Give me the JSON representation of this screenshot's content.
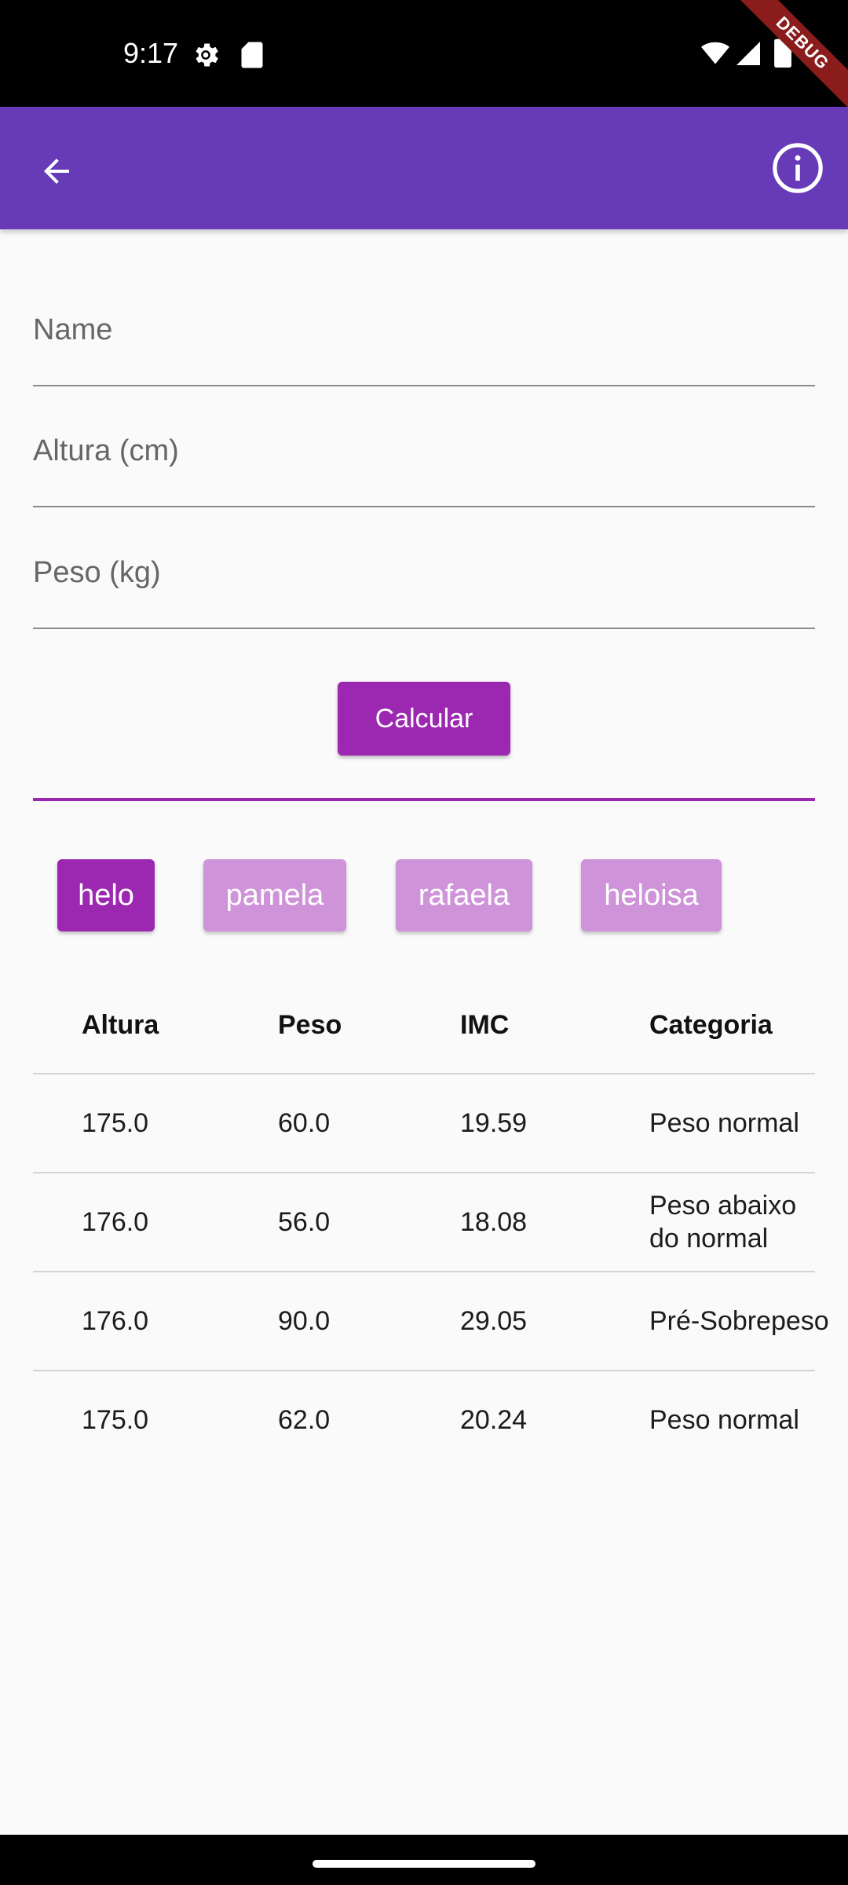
{
  "status_bar": {
    "time": "9:17",
    "debug_label": "DEBUG",
    "icons": [
      "settings-gear-icon",
      "sd-card-icon",
      "wifi-icon",
      "cell-signal-icon",
      "battery-icon"
    ]
  },
  "app_bar": {
    "color": "#673ab7",
    "back_icon": "arrow-back-icon",
    "info_icon": "info-outline-icon"
  },
  "form": {
    "name_placeholder": "Name",
    "name_value": "",
    "height_placeholder": "Altura (cm)",
    "height_value": "",
    "weight_placeholder": "Peso (kg)",
    "weight_value": "",
    "calculate_label": "Calcular"
  },
  "colors": {
    "accent": "#9c27b0",
    "chip_selected": "#9c27b0",
    "chip_unselected": "#ce93d8"
  },
  "people": [
    {
      "label": "helo",
      "selected": true
    },
    {
      "label": "pamela",
      "selected": false
    },
    {
      "label": "rafaela",
      "selected": false
    },
    {
      "label": "heloisa",
      "selected": false
    }
  ],
  "table": {
    "headers": [
      "Altura",
      "Peso",
      "IMC",
      "Categoria"
    ],
    "rows": [
      [
        "175.0",
        "60.0",
        "19.59",
        "Peso normal"
      ],
      [
        "176.0",
        "56.0",
        "18.08",
        "Peso abaixo\ndo normal"
      ],
      [
        "176.0",
        "90.0",
        "29.05",
        "Pré-Sobrepeso"
      ],
      [
        "175.0",
        "62.0",
        "20.24",
        "Peso normal"
      ]
    ]
  }
}
